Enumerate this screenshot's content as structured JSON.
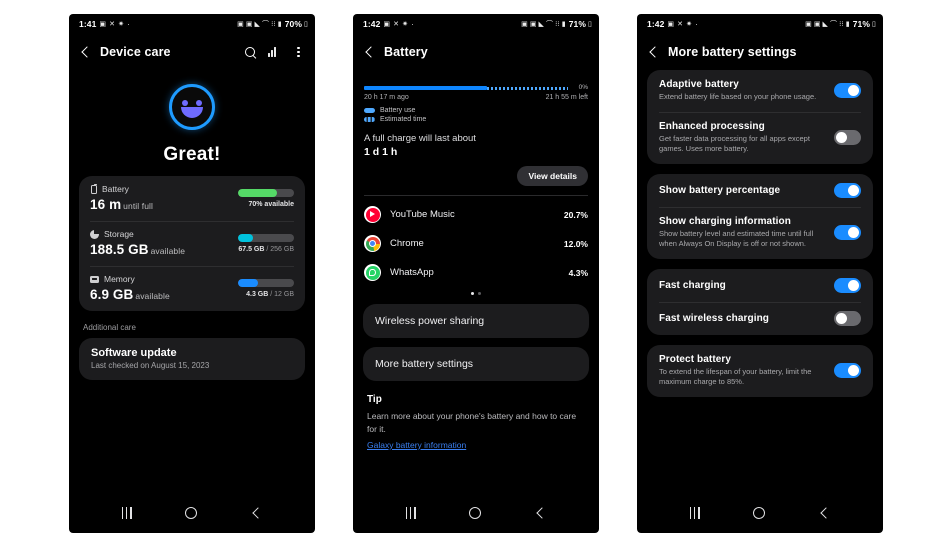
{
  "phone1": {
    "statusbar": {
      "time": "1:41",
      "left_icons": [
        "screenshot-icon",
        "no-sound-icon",
        "settings-icon",
        "dot-icon"
      ],
      "right_icons": [
        "alarm-icon",
        "dnd-icon",
        "mute-icon",
        "wifi-icon",
        "network-icon",
        "signal-icon"
      ],
      "battery_percent": "70%"
    },
    "appbar": {
      "title": "Device care",
      "back": "back-chevron",
      "actions": [
        "search-icon",
        "bars-chart-icon",
        "overflow-menu-icon"
      ]
    },
    "hero": {
      "title": "Great!",
      "face": "smiling-robot-face"
    },
    "metrics": [
      {
        "icon": "battery-icon",
        "label": "Battery",
        "value": "16 m",
        "value_sub": "until full",
        "bar_percent": 70,
        "bar_color": "#55d967",
        "caption": "70% available",
        "caption_muted": ""
      },
      {
        "icon": "storage-icon",
        "label": "Storage",
        "value": "188.5 GB",
        "value_sub": "available",
        "bar_percent": 26,
        "bar_color": "#00c2dd",
        "caption": "67.5 GB",
        "caption_muted": " / 256 GB"
      },
      {
        "icon": "memory-icon",
        "label": "Memory",
        "value": "6.9 GB",
        "value_sub": "available",
        "bar_percent": 36,
        "bar_color": "#1a8cff",
        "caption": "4.3 GB",
        "caption_muted": " / 12 GB"
      }
    ],
    "additional_label": "Additional care",
    "software_update": {
      "title": "Software update",
      "subtitle": "Last checked on August 15, 2023"
    },
    "nav": [
      "recents-button",
      "home-button",
      "back-button"
    ]
  },
  "phone2": {
    "statusbar": {
      "time": "1:42",
      "battery_percent": "71%"
    },
    "appbar": {
      "title": "Battery"
    },
    "chart": {
      "left_label": "20 h 17 m ago",
      "right_label": "21 h 55 m left",
      "axis_pct": "0%",
      "legend": [
        {
          "name": "battery-use-legend",
          "label": "Battery use"
        },
        {
          "name": "estimated-time-legend",
          "label": "Estimated time"
        }
      ]
    },
    "full_charge": {
      "line1": "A full charge will last about",
      "line2": "1 d 1 h"
    },
    "view_details": "View details",
    "apps": [
      {
        "icon": "youtube-music-icon",
        "name": "YouTube Music",
        "percent": "20.7%"
      },
      {
        "icon": "chrome-icon",
        "name": "Chrome",
        "percent": "12.0%"
      },
      {
        "icon": "whatsapp-icon",
        "name": "WhatsApp",
        "percent": "4.3%"
      }
    ],
    "page_dots": {
      "count": 2,
      "active": 0
    },
    "rows": [
      {
        "name": "wireless-power-sharing-row",
        "label": "Wireless power sharing"
      },
      {
        "name": "more-battery-settings-row",
        "label": "More battery settings"
      }
    ],
    "tip": {
      "title": "Tip",
      "body": "Learn more about your phone's battery and how to care for it.",
      "link": "Galaxy battery information"
    }
  },
  "phone3": {
    "statusbar": {
      "time": "1:42",
      "battery_percent": "71%"
    },
    "appbar": {
      "title": "More battery settings"
    },
    "groups": [
      {
        "name": "group-battery-optimization",
        "rows": [
          {
            "name": "adaptive-battery-row",
            "title": "Adaptive battery",
            "desc": "Extend battery life based on your phone usage.",
            "toggle": "on"
          },
          {
            "name": "enhanced-processing-row",
            "title": "Enhanced processing",
            "desc": "Get faster data processing for all apps except games. Uses more battery.",
            "toggle": "off"
          }
        ]
      },
      {
        "name": "group-display",
        "rows": [
          {
            "name": "show-battery-percentage-row",
            "title": "Show battery percentage",
            "desc": "",
            "toggle": "on"
          },
          {
            "name": "show-charging-information-row",
            "title": "Show charging information",
            "desc": "Show battery level and estimated time until full when Always On Display is off or not shown.",
            "toggle": "on"
          }
        ]
      },
      {
        "name": "group-charging",
        "rows": [
          {
            "name": "fast-charging-row",
            "title": "Fast charging",
            "desc": "",
            "toggle": "on"
          },
          {
            "name": "fast-wireless-charging-row",
            "title": "Fast wireless charging",
            "desc": "",
            "toggle": "off"
          }
        ]
      },
      {
        "name": "group-protect",
        "rows": [
          {
            "name": "protect-battery-row",
            "title": "Protect battery",
            "desc": "To extend the lifespan of your battery, limit the maximum charge to 85%.",
            "toggle": "on"
          }
        ]
      }
    ]
  },
  "colors": {
    "accent_blue": "#1a8cff",
    "battery_green": "#55d967",
    "storage_cyan": "#00c2dd",
    "memory_blue": "#1a8cff",
    "link_blue": "#3a7ff0",
    "card_bg": "#1c1c1e",
    "screen_bg": "#000000"
  }
}
